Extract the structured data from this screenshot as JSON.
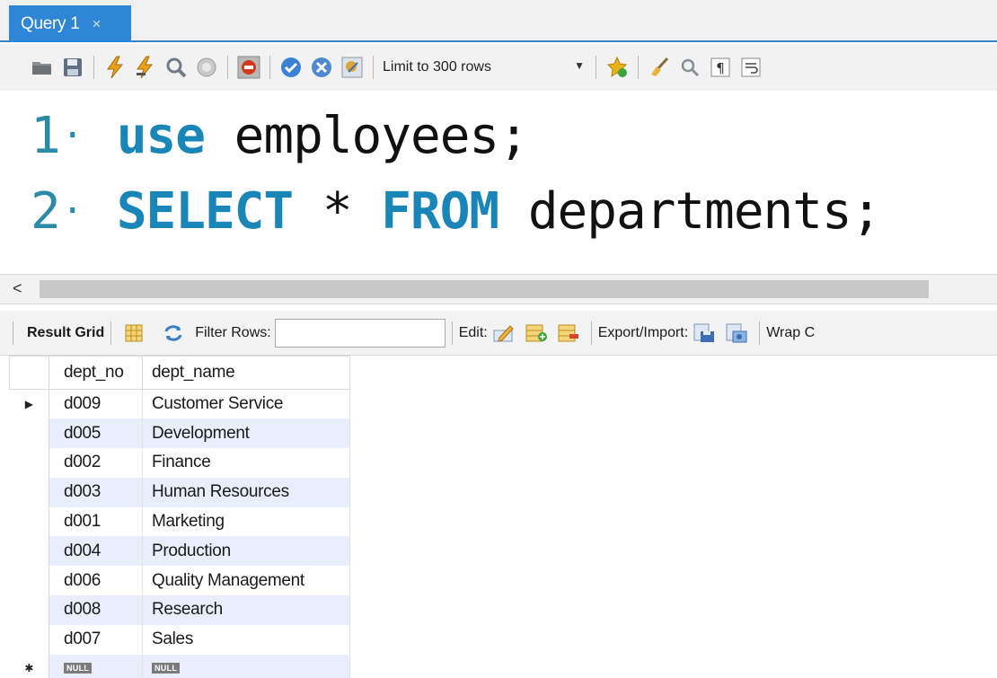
{
  "tab": {
    "label": "Query 1",
    "close_glyph": "×"
  },
  "toolbar": {
    "icons": [
      "open-folder-icon",
      "save-icon",
      "execute-lightning-icon",
      "execute-cursor-lightning-icon",
      "explain-magnifier-icon",
      "stop-icon",
      "toggle-continue-on-error-icon",
      "commit-icon",
      "rollback-icon",
      "autocommit-icon"
    ],
    "limit_label": "Limit to 300 rows",
    "right_icons": [
      "add-snippet-star-icon",
      "beautify-broom-icon",
      "find-icon",
      "invisible-chars-icon",
      "wrap-lines-icon"
    ]
  },
  "editor": {
    "lines": [
      {
        "num": "1",
        "dot": "·",
        "tokens": [
          {
            "t": "use",
            "kw": true
          },
          {
            "t": " employees;",
            "kw": false
          }
        ]
      },
      {
        "num": "2",
        "dot": "·",
        "tokens": [
          {
            "t": "SELECT",
            "kw": true
          },
          {
            "t": " * ",
            "kw": false
          },
          {
            "t": "FROM",
            "kw": true
          },
          {
            "t": " departments;",
            "kw": false
          }
        ]
      }
    ]
  },
  "scrollbar": {
    "left_arrow": "<"
  },
  "result_toolbar": {
    "result_grid_label": "Result Grid",
    "filter_label": "Filter Rows:",
    "filter_value": "",
    "edit_label": "Edit:",
    "export_label": "Export/Import:",
    "wrap_label": "Wrap C"
  },
  "grid": {
    "columns": [
      "dept_no",
      "dept_name"
    ],
    "rows": [
      [
        "d009",
        "Customer Service"
      ],
      [
        "d005",
        "Development"
      ],
      [
        "d002",
        "Finance"
      ],
      [
        "d003",
        "Human Resources"
      ],
      [
        "d001",
        "Marketing"
      ],
      [
        "d004",
        "Production"
      ],
      [
        "d006",
        "Quality Management"
      ],
      [
        "d008",
        "Research"
      ],
      [
        "d007",
        "Sales"
      ]
    ],
    "current_row_marker": "▶",
    "new_row_marker": "✱",
    "null_label": "NULL"
  },
  "colors": {
    "tab_blue": "#2f86d6",
    "keyword": "#1a86b8",
    "line_number": "#2a8aa8",
    "alt_row": "#e8eefb"
  }
}
